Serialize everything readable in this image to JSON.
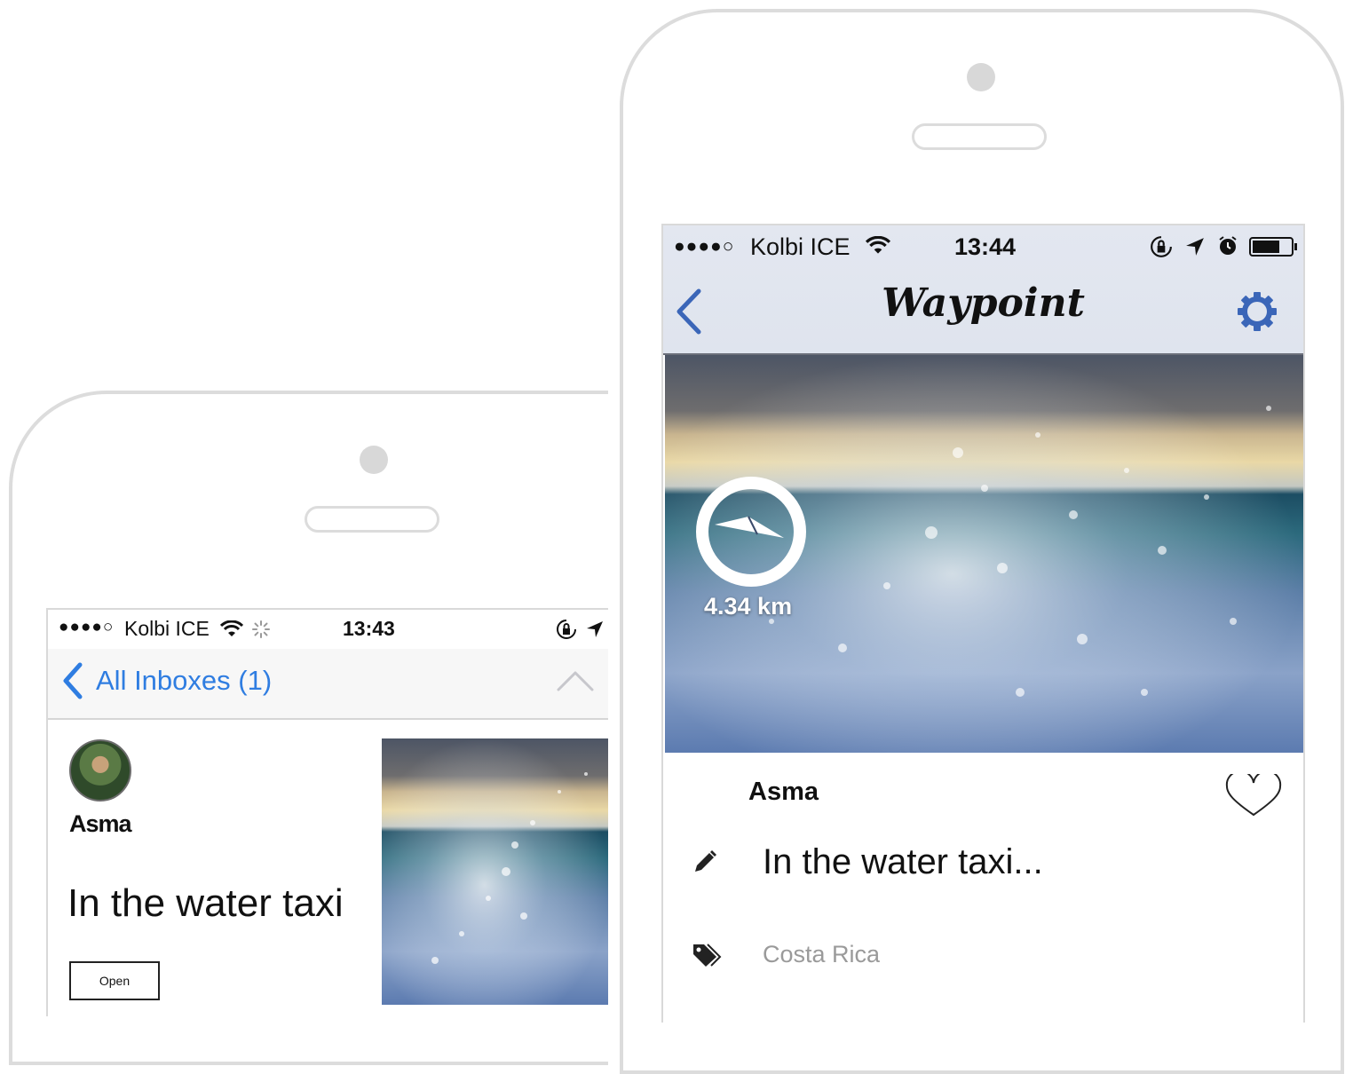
{
  "left_phone": {
    "status_bar": {
      "signal": "●●●●○",
      "carrier": "Kolbi ICE",
      "time": "13:43"
    },
    "nav": {
      "back_label": "All Inboxes (1)"
    },
    "message": {
      "sender": "Asma",
      "subject": "In the water taxi",
      "open_label": "Open"
    }
  },
  "right_phone": {
    "status_bar": {
      "signal": "●●●●○",
      "carrier": "Kolbi ICE",
      "time": "13:44"
    },
    "nav": {
      "title": "Waypoint"
    },
    "photo": {
      "distance": "4.34 km"
    },
    "post": {
      "author": "Asma",
      "caption": "In the water taxi...",
      "tag": "Costa Rica"
    }
  },
  "colors": {
    "accent_blue": "#2f7de1",
    "waypoint_blue": "#3b66b8",
    "tag_gray": "#9a9a9a"
  },
  "icons": [
    "chevron-left-icon",
    "chevron-up-icon",
    "wifi-icon",
    "spinner-icon",
    "rotation-lock-icon",
    "location-arrow-icon",
    "alarm-icon",
    "battery-icon",
    "gear-icon",
    "compass-icon",
    "heart-icon",
    "pencil-icon",
    "tag-icon"
  ]
}
